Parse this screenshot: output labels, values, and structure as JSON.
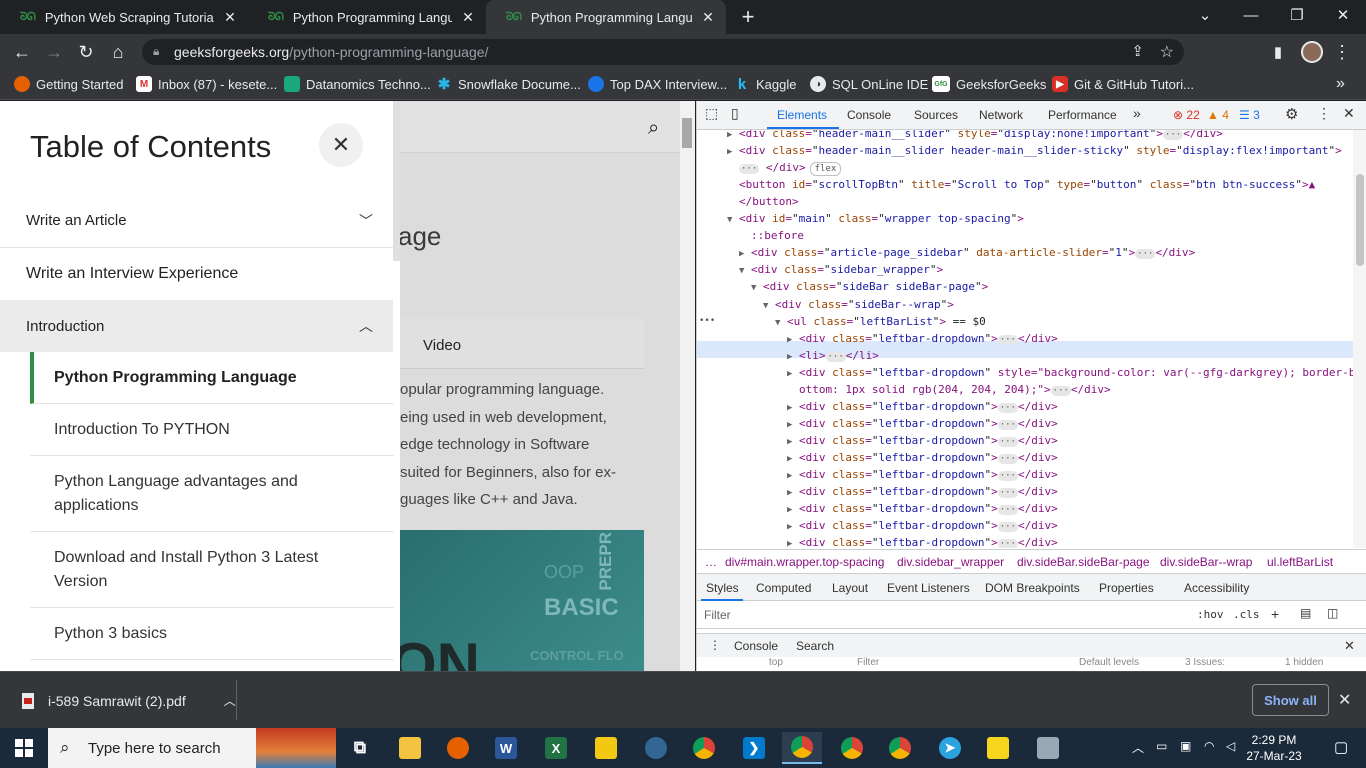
{
  "browser": {
    "tabs": [
      {
        "title": "Python Web Scraping Tutorial - G",
        "favicon": "gfg-icon"
      },
      {
        "title": "Python Programming Language",
        "favicon": "gfg-icon"
      },
      {
        "title": "Python Programming Language",
        "favicon": "gfg-icon",
        "active": true
      }
    ],
    "new_tab": "+",
    "url_domain": "geeksforgeeks.org",
    "url_path": "/python-programming-language/"
  },
  "bookmarks": [
    {
      "label": "Getting Started",
      "color": "#e66000",
      "glyph": ""
    },
    {
      "label": "Inbox (87) - kesete...",
      "color": "#d93025",
      "glyph": "M"
    },
    {
      "label": "Datanomics Techno...",
      "color": "#18a87a",
      "glyph": ""
    },
    {
      "label": "Snowflake Docume...",
      "color": "#29b5e8",
      "glyph": "✱"
    },
    {
      "label": "Top DAX Interview...",
      "color": "#1a73e8",
      "glyph": ""
    },
    {
      "label": "Kaggle",
      "color": "#35363a",
      "glyph": "k"
    },
    {
      "label": "SQL OnLine IDE",
      "color": "#35363a",
      "glyph": "◑"
    },
    {
      "label": "GeeksforGeeks",
      "color": "#ffffff",
      "glyph": "GfG"
    },
    {
      "label": "Git & GitHub Tutori...",
      "color": "#d93025",
      "glyph": ""
    }
  ],
  "toc": {
    "title": "Table of Contents",
    "sections": [
      {
        "label": "Write an Article"
      },
      {
        "label": "Write an Interview Experience"
      },
      {
        "label": "Introduction"
      }
    ],
    "items": [
      {
        "label": "Python Programming Language",
        "active": true
      },
      {
        "label": "Introduction To PYTHON"
      },
      {
        "label": "Python Language advantages and applications"
      },
      {
        "label": "Download and Install Python 3 Latest Version"
      },
      {
        "label": "Python 3 basics"
      }
    ]
  },
  "article": {
    "title_fragment": "age",
    "video_tab": "Video",
    "lines": [
      "opular programming language.",
      "eing used in web development,",
      "edge technology in Software",
      " suited for Beginners, also for ex-",
      "guages like C++ and Java."
    ],
    "hero_words": {
      "main": "BASIC",
      "top": "OOP",
      "vertical": "PREPR",
      "bottom": "CONTROL FLO",
      "big": "ON"
    }
  },
  "devtools": {
    "tabs": [
      "Elements",
      "Console",
      "Sources",
      "Network",
      "Performance"
    ],
    "errors": "22",
    "warnings": "4",
    "issues": "3",
    "dom_lines": [
      {
        "indent": 0,
        "tri": "▶",
        "html": "<div class=\"header-main__slider\" style=\"display:none!important\">…</div>"
      },
      {
        "indent": 0,
        "tri": "▶",
        "html": "<div class=\"header-main__slider header-main__slider-sticky\" style=\"display:flex!important\">"
      },
      {
        "indent": 0,
        "tri": "",
        "html": "… </div>",
        "badge": "flex"
      },
      {
        "indent": 0,
        "tri": "",
        "html": "<button id=\"scrollTopBtn\" title=\"Scroll to Top\" type=\"button\" class=\"btn btn-success\">▲"
      },
      {
        "indent": 0,
        "tri": "",
        "html": "</button>"
      },
      {
        "indent": 0,
        "tri": "▼",
        "html": "<div id=\"main\" class=\"wrapper top-spacing\">"
      },
      {
        "indent": 1,
        "tri": "",
        "html": "::before"
      },
      {
        "indent": 1,
        "tri": "▶",
        "html": "<div class=\"article-page_sidebar\" data-article-slider=\"1\">…</div>"
      },
      {
        "indent": 1,
        "tri": "▼",
        "html": "<div class=\"sidebar_wrapper\">"
      },
      {
        "indent": 2,
        "tri": "▼",
        "html": "<div class=\"sideBar sideBar-page\">"
      },
      {
        "indent": 3,
        "tri": "▼",
        "html": "<div class=\"sideBar--wrap\">"
      },
      {
        "indent": 4,
        "tri": "▼",
        "html": "<ul class=\"leftBarList\"> == $0"
      },
      {
        "indent": 5,
        "tri": "▶",
        "html": "<div class=\"leftbar-dropdown\">…</div>"
      },
      {
        "indent": 5,
        "tri": "▶",
        "html": "<li>…</li>"
      },
      {
        "indent": 5,
        "tri": "▶",
        "html": "<div class=\"leftbar-dropdown\" style=\"background-color: var(--gfg-darkgrey); border-b"
      },
      {
        "indent": 5,
        "tri": "",
        "html": "ottom: 1px solid rgb(204, 204, 204);\">…</div>"
      },
      {
        "indent": 5,
        "tri": "▶",
        "html": "<div class=\"leftbar-dropdown\">…</div>"
      },
      {
        "indent": 5,
        "tri": "▶",
        "html": "<div class=\"leftbar-dropdown\">…</div>"
      },
      {
        "indent": 5,
        "tri": "▶",
        "html": "<div class=\"leftbar-dropdown\">…</div>"
      },
      {
        "indent": 5,
        "tri": "▶",
        "html": "<div class=\"leftbar-dropdown\">…</div>"
      },
      {
        "indent": 5,
        "tri": "▶",
        "html": "<div class=\"leftbar-dropdown\">…</div>"
      },
      {
        "indent": 5,
        "tri": "▶",
        "html": "<div class=\"leftbar-dropdown\">…</div>"
      },
      {
        "indent": 5,
        "tri": "▶",
        "html": "<div class=\"leftbar-dropdown\">…</div>"
      },
      {
        "indent": 5,
        "tri": "▶",
        "html": "<div class=\"leftbar-dropdown\">…</div>"
      },
      {
        "indent": 5,
        "tri": "▶",
        "html": "<div class=\"leftbar-dropdown\">…</div>"
      }
    ],
    "breadcrumbs": [
      "…",
      "div#main.wrapper.top-spacing",
      "div.sidebar_wrapper",
      "div.sideBar.sideBar-page",
      "div.sideBar--wrap",
      "ul.leftBarList"
    ],
    "style_tabs": [
      "Styles",
      "Computed",
      "Layout",
      "Event Listeners",
      "DOM Breakpoints",
      "Properties",
      "Accessibility"
    ],
    "filter_placeholder": "Filter",
    "hov": ":hov",
    "cls": ".cls",
    "drawer_tabs": [
      "Console",
      "Search"
    ],
    "drawer_peek": [
      "top",
      "Filter",
      "Default levels",
      "3 Issues:",
      "1 hidden"
    ]
  },
  "download": {
    "file": "i-589  Samrawit (2).pdf",
    "show_all": "Show all"
  },
  "taskbar": {
    "search_placeholder": "Type here to search",
    "time": "2:29 PM",
    "date": "27-Mar-23"
  }
}
